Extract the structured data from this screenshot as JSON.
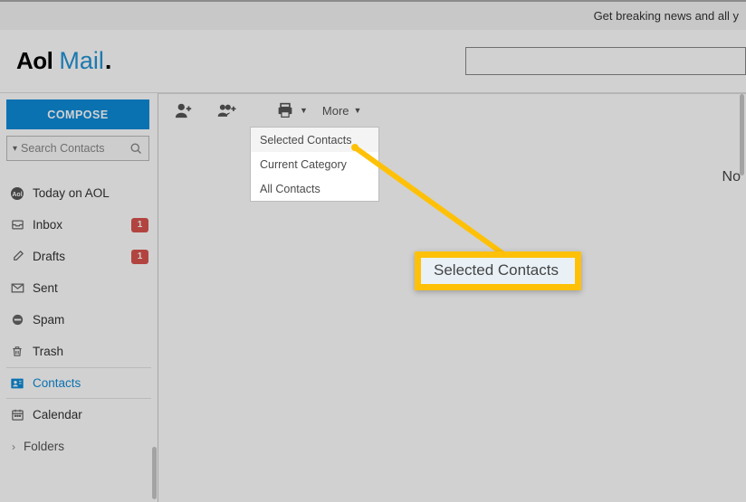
{
  "banner": {
    "text": "Get breaking news and all y"
  },
  "logo": {
    "aol": "Aol",
    "mail": "Mail",
    "dot": "."
  },
  "compose": "COMPOSE",
  "search_contacts": {
    "placeholder": "Search Contacts"
  },
  "nav": {
    "today": "Today on AOL",
    "inbox": {
      "label": "Inbox",
      "badge": "1"
    },
    "drafts": {
      "label": "Drafts",
      "badge": "1"
    },
    "sent": "Sent",
    "spam": "Spam",
    "trash": "Trash",
    "contacts": "Contacts",
    "calendar": "Calendar",
    "folders": "Folders"
  },
  "toolbar": {
    "more": "More"
  },
  "dropdown": {
    "selected": "Selected Contacts",
    "current": "Current Category",
    "all": "All Contacts"
  },
  "content": {
    "no": "No "
  },
  "callout": {
    "text": "Selected Contacts"
  }
}
